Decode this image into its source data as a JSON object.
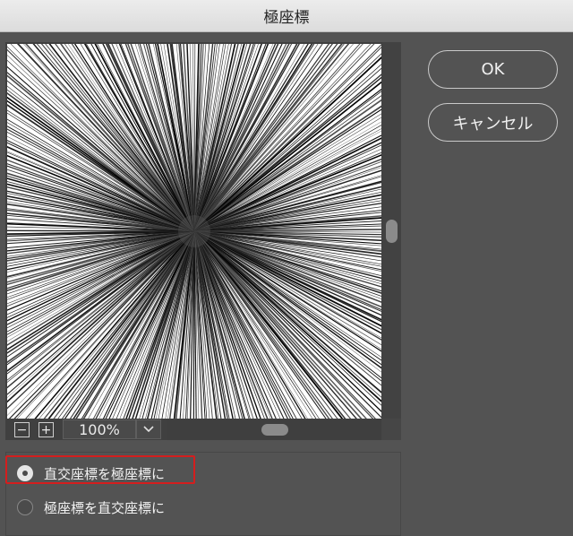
{
  "dialog": {
    "title": "極座標"
  },
  "preview": {
    "zoom_value": "100%",
    "zoom_out_symbol": "−",
    "zoom_in_symbol": "+"
  },
  "buttons": {
    "ok_label": "OK",
    "cancel_label": "キャンセル"
  },
  "options": [
    {
      "label": "直交座標を極座標に",
      "selected": true
    },
    {
      "label": "極座標を直交座標に",
      "selected": false
    }
  ],
  "colors": {
    "dialog_bg": "#535353",
    "highlight_border": "#d41e1e"
  }
}
